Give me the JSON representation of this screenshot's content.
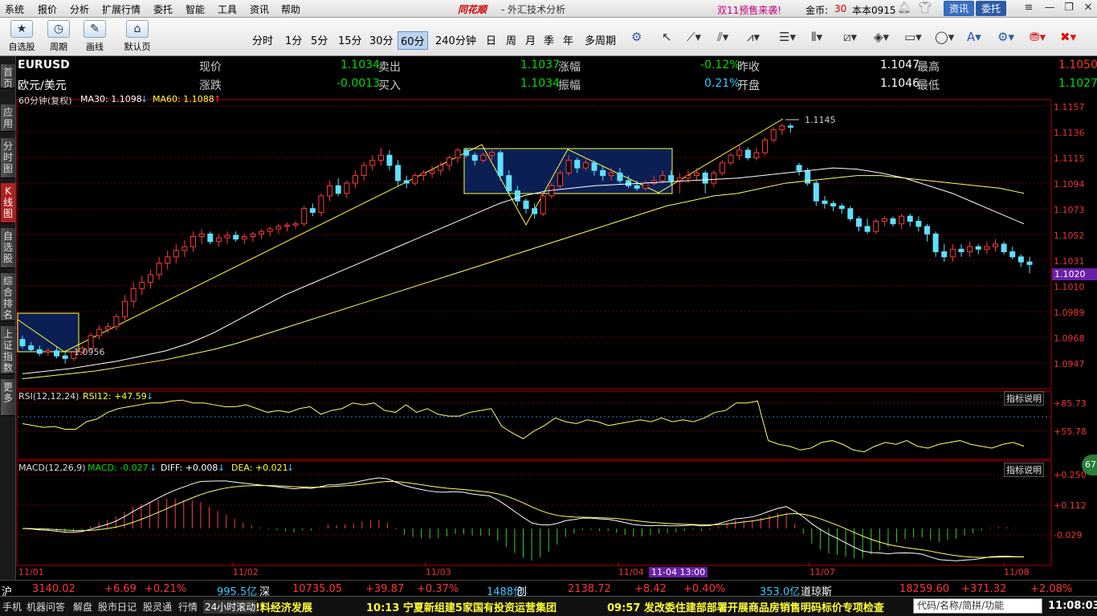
{
  "menu": [
    "系统",
    "报价",
    "分析",
    "扩展行情",
    "委托",
    "智能",
    "工具",
    "资讯",
    "帮助"
  ],
  "brand": "同花顺",
  "app_title": "- 外汇技术分析",
  "promo": "双11预售来袭!",
  "coins_label": "金币:",
  "coins": "30",
  "account": "本本0915",
  "btn_news": "资讯",
  "btn_trade": "委托",
  "toolbar": {
    "buttons": [
      "自选股",
      "周期",
      "画线",
      "默认页"
    ],
    "periods": [
      "分时",
      "1分",
      "5分",
      "15分",
      "30分",
      "60分",
      "240分钟",
      "日",
      "周",
      "月",
      "季",
      "年",
      "多周期"
    ],
    "active_period": "60分"
  },
  "sidebar": [
    "首页",
    "应用",
    "分时图",
    "K线图",
    "自选股",
    "综合排名",
    "上证指数",
    "更多"
  ],
  "quote": {
    "symbol": "EURUSD",
    "name": "欧元/美元",
    "r1": [
      [
        "现价",
        "1.1034"
      ],
      [
        "卖出",
        "1.1037"
      ],
      [
        "涨幅",
        "-0.12%"
      ],
      [
        "昨收",
        "1.1047"
      ],
      [
        "最高",
        "1.1050"
      ]
    ],
    "r2": [
      [
        "涨跌",
        "-0.0013"
      ],
      [
        "买入",
        "1.1034"
      ],
      [
        "振幅",
        "0.21%"
      ],
      [
        "开盘",
        "1.1046"
      ],
      [
        "最低",
        "1.1027"
      ]
    ]
  },
  "ma_bar": {
    "period": "60分钟(复权)",
    "ma30": "MA30: 1.1098",
    "ma60": "MA60: 1.1088"
  },
  "rsi_label": "RSI(12,12,24)",
  "rsi12": "RSI12: +47.59",
  "macd_label": "MACD(12,26,9)",
  "macd": "MACD: -0.027",
  "diff": "DIFF: +0.008",
  "dea": "DEA: +0.021",
  "indicator_help": "指标说明",
  "price_ticks": [
    "1.1157",
    "1.1136",
    "1.1115",
    "1.1094",
    "1.1073",
    "1.1052",
    "1.1031",
    "1.1010",
    "1.0989",
    "1.0968",
    "1.0947"
  ],
  "current_price": "1.1020",
  "rsi_ticks": [
    "+85.73",
    "+55.78"
  ],
  "macd_ticks": [
    "+0.250",
    "+0.112",
    "-0.029"
  ],
  "dates": [
    "11/01",
    "11/02",
    "11/03",
    "11/04",
    "11/07",
    "11/08"
  ],
  "cursor_time": "11-04 13:00",
  "high_mark": "1.1145",
  "low_mark": "1.0956",
  "badge": "67",
  "status": {
    "sh_label": "沪",
    "sh": "3140.02",
    "sh_chg": "+6.69",
    "sh_pct": "+0.21%",
    "sh_vol": "995.5亿",
    "sz_label": "深",
    "sz": "10735.05",
    "sz_chg": "+39.87",
    "sz_pct": "+0.37%",
    "sz_vol": "1488亿",
    "cy_label": "创",
    "cy": "2138.72",
    "cy_chg": "+8.42",
    "cy_pct": "+0.40%",
    "cy_vol": "353.0亿",
    "dj_label": "道琼斯",
    "dj": "18259.60",
    "dj_chg": "+371.32",
    "dj_pct": "+2.08%"
  },
  "bottom": {
    "tabs": [
      "手机",
      "机器问答",
      "解盘",
      "股市日记",
      "股灵通",
      "行情",
      "24小时滚动"
    ],
    "news1": "!料经济发展",
    "news2": "10:13 宁夏新组建5家国有投资运营集团",
    "news3": "09:57 发改委住建部部署开展商品房销售明码标价专项检查",
    "search_placeholder": "代码/名称/简拼/功能",
    "clock": "11:08:03"
  },
  "chart_data": {
    "type": "candlestick",
    "symbol": "EURUSD",
    "interval": "60分钟",
    "ylim": [
      1.094,
      1.116
    ],
    "x_labels": [
      "11/01",
      "11/02",
      "11/03",
      "11/04",
      "11/07",
      "11/08"
    ],
    "ohlc": [
      [
        1.0975,
        1.0978,
        1.0968,
        1.097
      ],
      [
        1.097,
        1.0973,
        1.0965,
        1.0967
      ],
      [
        1.0967,
        1.097,
        1.0962,
        1.0964
      ],
      [
        1.0965,
        1.0968,
        1.0962,
        1.0966
      ],
      [
        1.0966,
        1.0969,
        1.096,
        1.0962
      ],
      [
        1.0962,
        1.0965,
        1.0956,
        1.096
      ],
      [
        1.096,
        1.0966,
        1.0958,
        1.0965
      ],
      [
        1.0965,
        1.097,
        1.0963,
        1.0968
      ],
      [
        1.0968,
        1.098,
        1.0966,
        1.0978
      ],
      [
        1.0978,
        1.0986,
        1.0975,
        1.0983
      ],
      [
        1.0983,
        1.0988,
        1.098,
        1.0985
      ],
      [
        1.0985,
        1.0995,
        1.0982,
        1.0993
      ],
      [
        1.0993,
        1.101,
        1.099,
        1.1005
      ],
      [
        1.1005,
        1.102,
        1.1,
        1.1015
      ],
      [
        1.1015,
        1.1025,
        1.101,
        1.102
      ],
      [
        1.102,
        1.103,
        1.1015,
        1.1026
      ],
      [
        1.1026,
        1.104,
        1.1022,
        1.1035
      ],
      [
        1.1035,
        1.1045,
        1.103,
        1.104
      ],
      [
        1.104,
        1.105,
        1.1035,
        1.1045
      ],
      [
        1.1045,
        1.1053,
        1.104,
        1.1048
      ],
      [
        1.1048,
        1.106,
        1.1044,
        1.1056
      ],
      [
        1.1056,
        1.1062,
        1.105,
        1.1058
      ],
      [
        1.1058,
        1.106,
        1.105,
        1.1052
      ],
      [
        1.1052,
        1.1058,
        1.1048,
        1.1055
      ],
      [
        1.1055,
        1.106,
        1.105,
        1.1057
      ],
      [
        1.1057,
        1.106,
        1.1052,
        1.1054
      ],
      [
        1.1054,
        1.1058,
        1.105,
        1.1056
      ],
      [
        1.1056,
        1.106,
        1.1052,
        1.1058
      ],
      [
        1.1058,
        1.1062,
        1.1054,
        1.106
      ],
      [
        1.106,
        1.1064,
        1.1056,
        1.1062
      ],
      [
        1.1062,
        1.1066,
        1.1058,
        1.1064
      ],
      [
        1.1064,
        1.1067,
        1.106,
        1.1065
      ],
      [
        1.1065,
        1.1068,
        1.1062,
        1.1066
      ],
      [
        1.1066,
        1.108,
        1.1064,
        1.1078
      ],
      [
        1.1078,
        1.1082,
        1.1072,
        1.1075
      ],
      [
        1.1075,
        1.109,
        1.1072,
        1.1088
      ],
      [
        1.1088,
        1.11,
        1.1084,
        1.1096
      ],
      [
        1.1096,
        1.1102,
        1.1088,
        1.109
      ],
      [
        1.109,
        1.11,
        1.1086,
        1.1098
      ],
      [
        1.1098,
        1.1108,
        1.1094,
        1.1104
      ],
      [
        1.1104,
        1.1115,
        1.11,
        1.1112
      ],
      [
        1.1112,
        1.112,
        1.1108,
        1.1116
      ],
      [
        1.1116,
        1.1126,
        1.1112,
        1.112
      ],
      [
        1.112,
        1.1124,
        1.1108,
        1.1112
      ],
      [
        1.1112,
        1.1116,
        1.1096,
        1.11
      ],
      [
        1.11,
        1.1104,
        1.1094,
        1.1098
      ],
      [
        1.1098,
        1.1106,
        1.1096,
        1.1104
      ],
      [
        1.1104,
        1.1108,
        1.11,
        1.1106
      ],
      [
        1.1106,
        1.1112,
        1.1102,
        1.1108
      ],
      [
        1.1108,
        1.1115,
        1.1104,
        1.1112
      ],
      [
        1.1112,
        1.112,
        1.1108,
        1.1118
      ],
      [
        1.1118,
        1.1126,
        1.1114,
        1.1124
      ],
      [
        1.1124,
        1.1126,
        1.1118,
        1.112
      ],
      [
        1.112,
        1.1122,
        1.1112,
        1.1116
      ],
      [
        1.1116,
        1.1122,
        1.1114,
        1.112
      ],
      [
        1.112,
        1.1124,
        1.1116,
        1.1122
      ],
      [
        1.1122,
        1.1124,
        1.11,
        1.1104
      ],
      [
        1.1104,
        1.1108,
        1.1088,
        1.1092
      ],
      [
        1.1092,
        1.1096,
        1.108,
        1.1084
      ],
      [
        1.1084,
        1.1086,
        1.1074,
        1.1078
      ],
      [
        1.1078,
        1.1082,
        1.107,
        1.1074
      ],
      [
        1.1074,
        1.109,
        1.1072,
        1.1088
      ],
      [
        1.1088,
        1.1098,
        1.1086,
        1.1096
      ],
      [
        1.1096,
        1.1108,
        1.1094,
        1.1106
      ],
      [
        1.1106,
        1.112,
        1.1104,
        1.1116
      ],
      [
        1.1116,
        1.1118,
        1.1106,
        1.111
      ],
      [
        1.111,
        1.1118,
        1.1108,
        1.1114
      ],
      [
        1.1114,
        1.1116,
        1.1104,
        1.1108
      ],
      [
        1.1108,
        1.1112,
        1.11,
        1.1104
      ],
      [
        1.1104,
        1.111,
        1.11,
        1.1106
      ],
      [
        1.1106,
        1.111,
        1.1098,
        1.11
      ],
      [
        1.11,
        1.1104,
        1.1094,
        1.1096
      ],
      [
        1.1096,
        1.11,
        1.1092,
        1.1094
      ],
      [
        1.1094,
        1.11,
        1.1092,
        1.1098
      ],
      [
        1.1098,
        1.1104,
        1.1096,
        1.11
      ],
      [
        1.11,
        1.1108,
        1.1098,
        1.1104
      ],
      [
        1.1104,
        1.1108,
        1.1096,
        1.11
      ],
      [
        1.11,
        1.1106,
        1.109,
        1.1102
      ],
      [
        1.1102,
        1.1108,
        1.1098,
        1.1104
      ],
      [
        1.1104,
        1.111,
        1.11,
        1.1106
      ],
      [
        1.1106,
        1.1108,
        1.109,
        1.1098
      ],
      [
        1.1098,
        1.1108,
        1.1095,
        1.1106
      ],
      [
        1.1106,
        1.1116,
        1.1104,
        1.1114
      ],
      [
        1.1114,
        1.1122,
        1.1112,
        1.112
      ],
      [
        1.112,
        1.1128,
        1.1116,
        1.1124
      ],
      [
        1.1124,
        1.1126,
        1.1116,
        1.1118
      ],
      [
        1.1118,
        1.1126,
        1.1116,
        1.1122
      ],
      [
        1.1122,
        1.1134,
        1.112,
        1.1132
      ],
      [
        1.1132,
        1.1142,
        1.113,
        1.114
      ],
      [
        1.114,
        1.1145,
        1.1136,
        1.1143
      ],
      [
        1.1143,
        1.1145,
        1.1138,
        1.1142
      ],
      [
        1.1112,
        1.1114,
        1.1104,
        1.1108
      ],
      [
        1.1108,
        1.111,
        1.1096,
        1.1098
      ],
      [
        1.1098,
        1.11,
        1.108,
        1.1084
      ],
      [
        1.1084,
        1.1088,
        1.1078,
        1.1082
      ],
      [
        1.1082,
        1.1084,
        1.1076,
        1.108
      ],
      [
        1.108,
        1.1082,
        1.1074,
        1.1078
      ],
      [
        1.1078,
        1.108,
        1.1068,
        1.107
      ],
      [
        1.107,
        1.1072,
        1.106,
        1.1064
      ],
      [
        1.1064,
        1.107,
        1.1058,
        1.106
      ],
      [
        1.106,
        1.107,
        1.1058,
        1.1068
      ],
      [
        1.1068,
        1.1072,
        1.1064,
        1.107
      ],
      [
        1.107,
        1.1072,
        1.1064,
        1.1066
      ],
      [
        1.1066,
        1.1074,
        1.1062,
        1.1072
      ],
      [
        1.1072,
        1.1074,
        1.1064,
        1.1068
      ],
      [
        1.1068,
        1.1072,
        1.106,
        1.1064
      ],
      [
        1.1064,
        1.1066,
        1.1052,
        1.1058
      ],
      [
        1.1058,
        1.106,
        1.104,
        1.1044
      ],
      [
        1.1044,
        1.105,
        1.1036,
        1.104
      ],
      [
        1.104,
        1.105,
        1.1036,
        1.1046
      ],
      [
        1.1046,
        1.105,
        1.104,
        1.1044
      ],
      [
        1.1044,
        1.1052,
        1.104,
        1.1048
      ],
      [
        1.1048,
        1.105,
        1.1042,
        1.1046
      ],
      [
        1.1046,
        1.1052,
        1.1042,
        1.1048
      ],
      [
        1.1048,
        1.1054,
        1.1044,
        1.105
      ],
      [
        1.105,
        1.1052,
        1.1042,
        1.1044
      ],
      [
        1.1044,
        1.1048,
        1.1038,
        1.104
      ],
      [
        1.104,
        1.1042,
        1.1032,
        1.1036
      ],
      [
        1.1036,
        1.104,
        1.1027,
        1.1034
      ]
    ],
    "ma30": [
      1.0948,
      1.095,
      1.0952,
      1.0955,
      1.0958,
      1.0962,
      1.0966,
      1.0972,
      1.098,
      1.099,
      1.1,
      1.101,
      1.1018,
      1.1026,
      1.1034,
      1.1042,
      1.105,
      1.1058,
      1.1066,
      1.1074,
      1.1082,
      1.1088,
      1.1092,
      1.1094,
      1.1096,
      1.1097,
      1.1098,
      1.1099,
      1.11,
      1.1101,
      1.1102,
      1.1104,
      1.1106,
      1.1108,
      1.111,
      1.1109,
      1.1106,
      1.1102,
      1.1096,
      1.109,
      1.1082,
      1.1074,
      1.1066
    ],
    "ma60": [
      1.0944,
      1.0946,
      1.0948,
      1.095,
      1.0953,
      1.0956,
      1.0959,
      1.0963,
      1.0967,
      1.0972,
      1.0978,
      1.0984,
      1.099,
      1.0996,
      1.1002,
      1.1008,
      1.1014,
      1.102,
      1.1026,
      1.1032,
      1.1038,
      1.1044,
      1.105,
      1.1056,
      1.1062,
      1.1068,
      1.1074,
      1.108,
      1.1084,
      1.1088,
      1.109,
      1.1094,
      1.1098,
      1.11,
      1.1102,
      1.1104,
      1.1104,
      1.1102,
      1.11,
      1.1098,
      1.1096,
      1.1094,
      1.109
    ],
    "rsi": [
      58,
      56,
      54,
      55,
      52,
      52,
      60,
      63,
      70,
      74,
      76,
      78,
      80,
      80,
      82,
      83,
      80,
      80,
      78,
      76,
      76,
      78,
      74,
      70,
      72,
      70,
      74,
      76,
      68,
      72,
      74,
      80,
      78,
      80,
      72,
      70,
      78,
      70,
      74,
      68,
      66,
      66,
      70,
      72,
      74,
      55,
      48,
      42,
      50,
      56,
      64,
      60,
      58,
      62,
      60,
      56,
      58,
      60,
      62,
      60,
      64,
      60,
      62,
      60,
      64,
      70,
      72,
      80,
      80,
      82,
      40,
      36,
      34,
      30,
      32,
      38,
      40,
      36,
      30,
      28,
      34,
      38,
      36,
      40,
      34,
      32,
      36,
      38,
      40,
      36,
      34,
      32,
      36,
      38,
      34
    ]
  }
}
